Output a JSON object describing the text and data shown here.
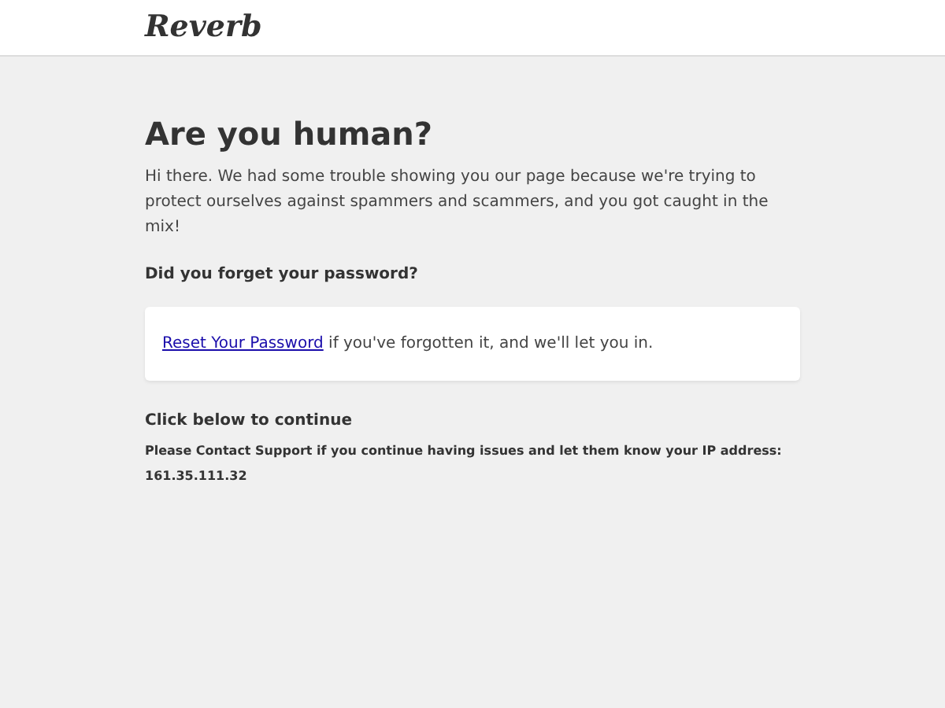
{
  "header": {
    "logo": "Reverb"
  },
  "title": "Are you human?",
  "intro": "Hi there. We had some trouble showing you our page because we're trying to protect ourselves against spammers and scammers, and you got caught in the mix!",
  "password_heading": "Did you forget your password?",
  "card": {
    "link": "Reset Your Password",
    "text": " if you've forgotten it, and we'll let you in."
  },
  "continue_heading": "Click below to continue",
  "support_note": "Please Contact Support if you continue having issues and let them know your IP address: 161.35.111.32"
}
